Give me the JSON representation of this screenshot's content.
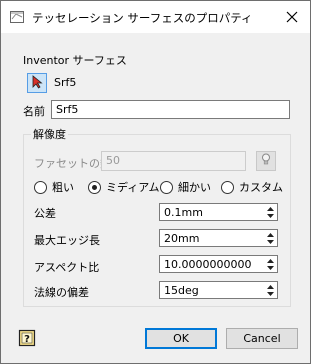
{
  "window": {
    "title": "テッセレーション サーフェスのプロパティ"
  },
  "source": {
    "label": "Inventor サーフェス",
    "surface_name": "Srf5"
  },
  "name_field": {
    "label": "名前",
    "value": "Srf5"
  },
  "resolution": {
    "group_title": "解像度",
    "facet_count_label": "ファセットの数",
    "facet_count_value": "50",
    "options": [
      {
        "label": "粗い",
        "selected": false
      },
      {
        "label": "ミディアム",
        "selected": true
      },
      {
        "label": "細かい",
        "selected": false
      },
      {
        "label": "カスタム",
        "selected": false
      }
    ],
    "params": [
      {
        "label": "公差",
        "value": "0.1mm"
      },
      {
        "label": "最大エッジ長",
        "value": "20mm"
      },
      {
        "label": "アスペクト比",
        "value": "10.0000000000"
      },
      {
        "label": "法線の偏差",
        "value": "15deg"
      }
    ]
  },
  "footer": {
    "ok_label": "OK",
    "cancel_label": "Cancel"
  },
  "icons": {
    "app": "surface-app-icon",
    "close": "close-icon",
    "pick": "select-arrow-icon",
    "bulb": "lightbulb-icon",
    "help": "help-icon"
  }
}
